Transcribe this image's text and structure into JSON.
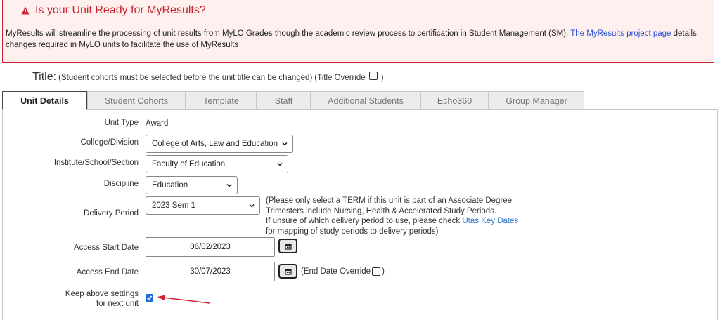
{
  "alert": {
    "title": "Is your Unit Ready for MyResults?",
    "body_text": "MyResults will streamline the processing of unit results from MyLO Grades though the academic review process to certification in Student Management (SM).",
    "link_text": "The MyResults project page",
    "body_suffix": "details changes required in MyLO units to facilitate the use of MyResults"
  },
  "title_section": {
    "label": "Title:",
    "note": "(Student cohorts must be selected before the unit title can be changed)",
    "override_label": "(Title Override",
    "override_close": ")"
  },
  "tabs": [
    {
      "label": "Unit Details",
      "active": true
    },
    {
      "label": "Student Cohorts"
    },
    {
      "label": "Template"
    },
    {
      "label": "Staff"
    },
    {
      "label": "Additional Students"
    },
    {
      "label": "Echo360"
    },
    {
      "label": "Group Manager"
    }
  ],
  "form": {
    "unit_type": {
      "label": "Unit Type",
      "value": "Award"
    },
    "college": {
      "label": "College/Division",
      "value": "College of Arts, Law and Education"
    },
    "institute": {
      "label": "Institute/School/Section",
      "value": "Faculty of Education"
    },
    "discipline": {
      "label": "Discipline",
      "value": "Education"
    },
    "delivery_period": {
      "label": "Delivery Period",
      "value": "2023 Sem 1"
    },
    "delivery_note": {
      "line1": "(Please only select a TERM if this unit is part of an Associate Degree",
      "line2": "Trimesters include Nursing, Health & Accelerated Study Periods.",
      "line3": "If unsure of which delivery period to use, please check",
      "link": "Utas Key Dates",
      "line4": "for mapping of study periods to delivery periods)"
    },
    "access_start": {
      "label": "Access Start Date",
      "value": "06/02/2023"
    },
    "access_end": {
      "label": "Access End Date",
      "value": "30/07/2023"
    },
    "end_override": {
      "label": "(End Date Override",
      "close": ")"
    },
    "keep_settings": {
      "label_line1": "Keep above settings",
      "label_line2": "for next unit",
      "checked": true
    }
  },
  "colors": {
    "alert": "#c8242f",
    "link": "#2b4fd6",
    "checkbox": "#1a6ed8",
    "arrow": "#d0202a"
  },
  "icons": [
    "warning-icon",
    "calendar-icon",
    "chevron-down-icon",
    "checkmark-icon",
    "annotation-arrow"
  ]
}
